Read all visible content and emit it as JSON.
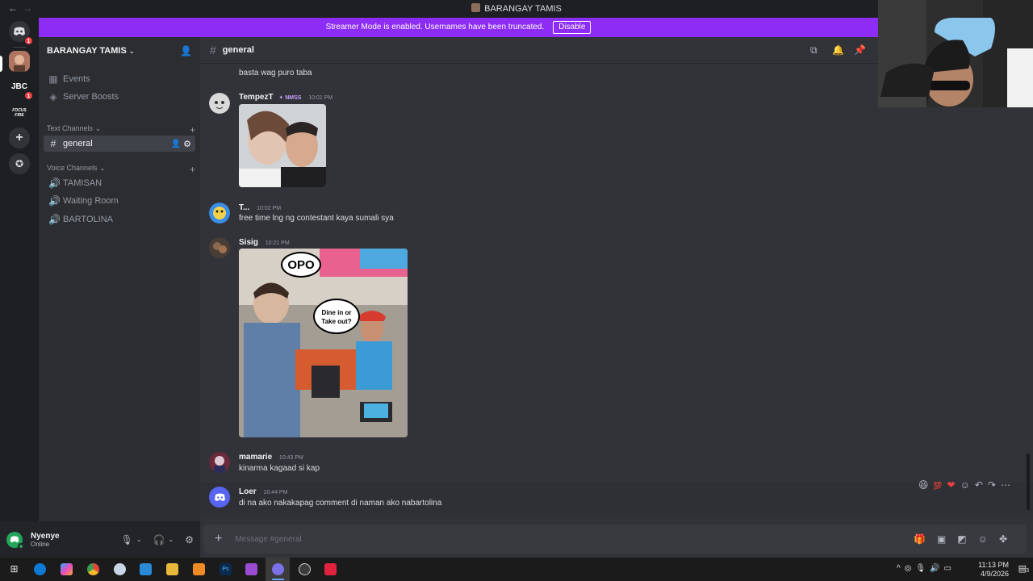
{
  "window": {
    "title": "BARANGAY TAMIS"
  },
  "banner": {
    "text": "Streamer Mode is enabled. Usernames have been truncated.",
    "button": "Disable"
  },
  "servers": [
    {
      "label": "",
      "badge": "1"
    },
    {
      "label": "",
      "badge": ""
    },
    {
      "label": "JBC",
      "badge": "1"
    },
    {
      "label": "FOCUS FIRE",
      "badge": ""
    }
  ],
  "sidebar": {
    "server_name": "BARANGAY TAMIS",
    "top_items": [
      {
        "label": "Events"
      },
      {
        "label": "Server Boosts"
      }
    ],
    "text_category": "Text Channels",
    "text_channels": [
      {
        "label": "general"
      }
    ],
    "voice_category": "Voice Channels",
    "voice_channels": [
      {
        "label": "TAMISAN"
      },
      {
        "label": "Waiting Room"
      },
      {
        "label": "BARTOLINA"
      }
    ]
  },
  "user": {
    "name": "Nyenye",
    "status": "Online"
  },
  "channel": {
    "name": "general"
  },
  "messages": [
    {
      "author": "",
      "time": "",
      "text": "basta wag puro taba"
    },
    {
      "author": "TempezT",
      "tag": "NMSS",
      "time": "10:01 PM",
      "text": ""
    },
    {
      "author": "T...",
      "time": "10:02 PM",
      "text": "free time lng ng contestant kaya sumali sya"
    },
    {
      "author": "Sisig",
      "time": "10:21 PM",
      "text": "",
      "meme_bubble1": "OPO",
      "meme_bubble2": "Dine in or Take out?"
    },
    {
      "author": "mamarie",
      "time": "10:43 PM",
      "text": "kinarma kagaad si kap"
    },
    {
      "author": "Loer",
      "time": "10:44 PM",
      "text": "di na ako nakakapag comment di naman ako nabartolina"
    }
  ],
  "composer": {
    "placeholder": "Message #general"
  },
  "clock": {
    "time": "11:13 PM",
    "date": "4/9/2026"
  },
  "notif_count": "3",
  "colors": {
    "accent": "#8c2cf5",
    "bg": "#313338",
    "sidebar": "#2b2d31"
  }
}
